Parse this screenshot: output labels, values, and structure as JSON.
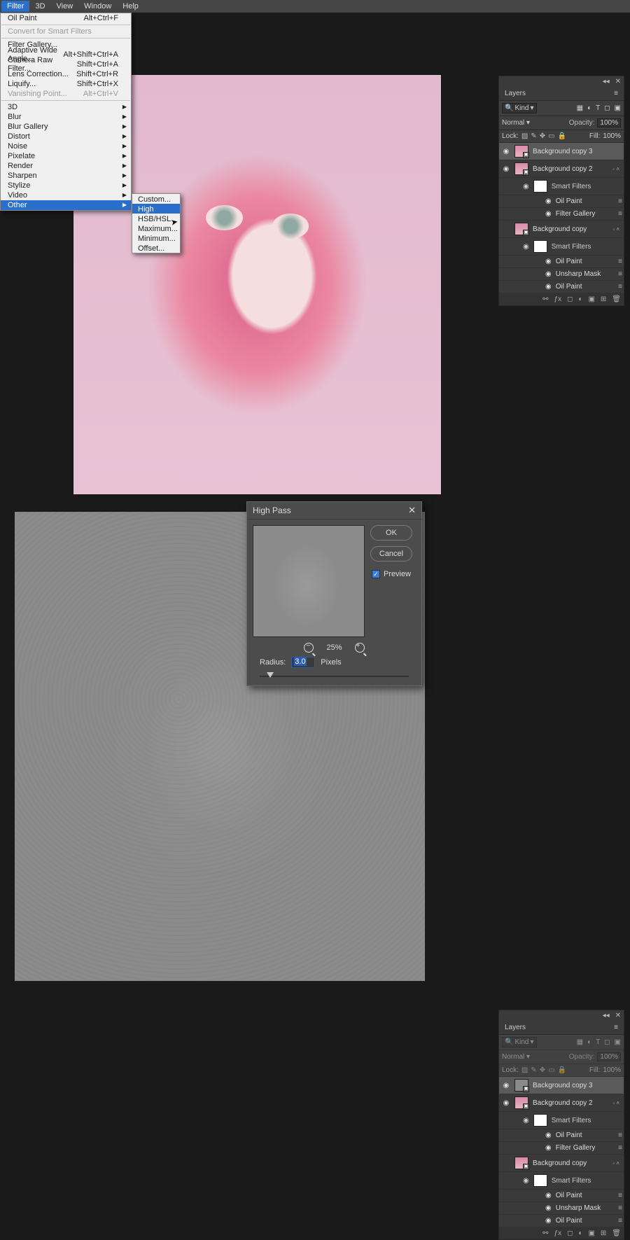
{
  "menubar": [
    "Filter",
    "3D",
    "View",
    "Window",
    "Help"
  ],
  "menubar_active_index": 0,
  "filter_menu": {
    "recent": {
      "label": "Oil Paint",
      "shortcut": "Alt+Ctrl+F"
    },
    "convert": "Convert for Smart Filters",
    "group1": [
      {
        "label": "Filter Gallery...",
        "shortcut": ""
      },
      {
        "label": "Adaptive Wide Angle...",
        "shortcut": "Alt+Shift+Ctrl+A"
      },
      {
        "label": "Camera Raw Filter...",
        "shortcut": "Shift+Ctrl+A"
      },
      {
        "label": "Lens Correction...",
        "shortcut": "Shift+Ctrl+R"
      },
      {
        "label": "Liquify...",
        "shortcut": "Shift+Ctrl+X"
      },
      {
        "label": "Vanishing Point...",
        "shortcut": "Alt+Ctrl+V"
      }
    ],
    "group2": [
      "3D",
      "Blur",
      "Blur Gallery",
      "Distort",
      "Noise",
      "Pixelate",
      "Render",
      "Sharpen",
      "Stylize",
      "Video",
      "Other"
    ],
    "highlight_index": 10
  },
  "submenu_other": [
    "Custom...",
    "High Pass...",
    "HSB/HSL",
    "Maximum...",
    "Minimum...",
    "Offset..."
  ],
  "submenu_highlight_index": 1,
  "layers_panel": {
    "title": "Layers",
    "filter_dropdown": "Kind",
    "blend_mode": "Normal",
    "opacity_label": "Opacity:",
    "opacity_value": "100%",
    "lock_label": "Lock:",
    "fill_label": "Fill:",
    "fill_value": "100%",
    "layers": [
      {
        "name": "Background copy 3",
        "selected": true,
        "grey_thumb_bottom": true
      },
      {
        "name": "Background copy 2",
        "smart_filters": [
          "Oil Paint",
          "Filter Gallery"
        ]
      },
      {
        "name": "Background copy",
        "smart_filters": [
          "Oil Paint",
          "Unsharp Mask",
          "Oil Paint"
        ]
      }
    ],
    "smart_filters_label": "Smart Filters"
  },
  "dialog": {
    "title": "High Pass",
    "ok": "OK",
    "cancel": "Cancel",
    "preview": "Preview",
    "preview_checked": true,
    "zoom_pct": "25%",
    "radius_label": "Radius:",
    "radius_value": "3.0",
    "radius_unit": "Pixels"
  }
}
